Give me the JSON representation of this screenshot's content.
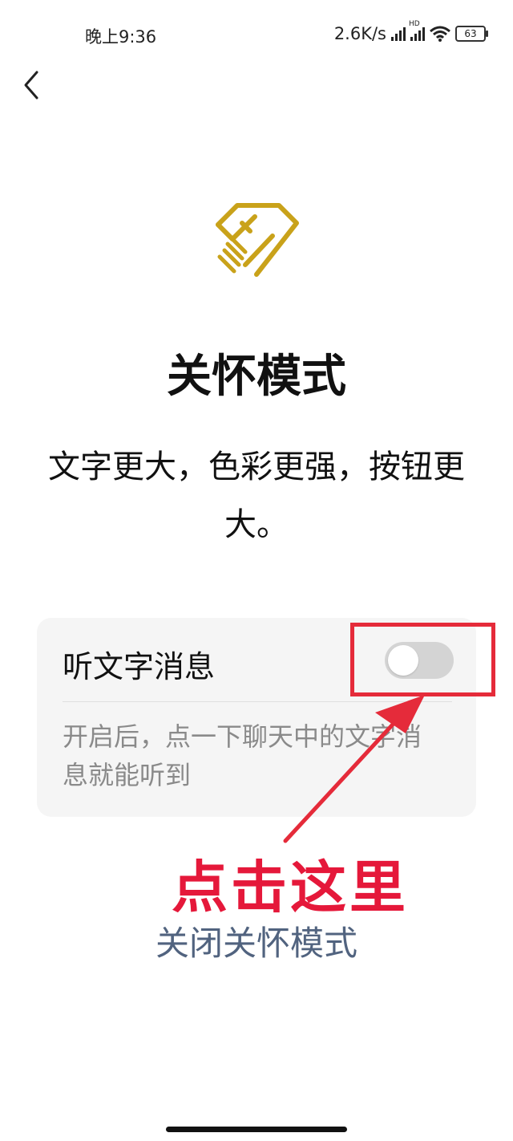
{
  "status_bar": {
    "time": "晚上9:36",
    "network_speed": "2.6K/s",
    "hd_label": "HD",
    "battery": "63",
    "icons": [
      "signal-icon",
      "hd-signal-icon",
      "wifi-icon",
      "battery-icon"
    ]
  },
  "nav": {
    "back_icon": "chevron-left-icon"
  },
  "logo": {
    "icon": "heart-hand-icon",
    "color": "#c9a21a"
  },
  "page": {
    "title": "关怀模式",
    "subtitle": "文字更大，色彩更强，按钮更大。"
  },
  "setting_card": {
    "label": "听文字消息",
    "toggle_on": false,
    "description": "开启后，点一下聊天中的文字消息就能听到"
  },
  "annotation": {
    "text": "点击这里",
    "color": "#e5183a"
  },
  "close_link": "关闭关怀模式",
  "colors": {
    "accent_red": "#e52b3a",
    "link_blue": "#51637f",
    "logo_gold": "#c9a21a"
  }
}
